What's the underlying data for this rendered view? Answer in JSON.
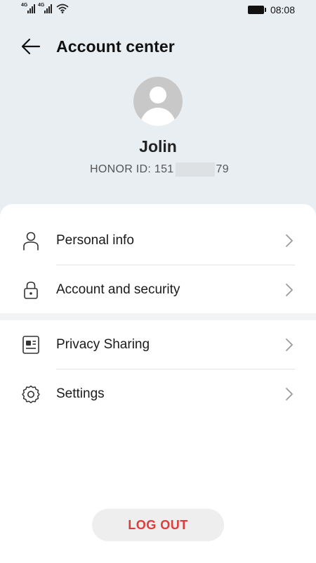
{
  "status_bar": {
    "sim1_label": "4G",
    "sim2_label": "4G",
    "time": "08:08"
  },
  "header": {
    "title": "Account center"
  },
  "profile": {
    "name": "Jolin",
    "id_prefix": "HONOR ID: 151",
    "id_suffix": "79"
  },
  "menu": {
    "group1": [
      {
        "label": "Personal info",
        "icon": "person-icon"
      },
      {
        "label": "Account and security",
        "icon": "lock-icon"
      }
    ],
    "group2": [
      {
        "label": "Privacy Sharing",
        "icon": "id-card-icon"
      },
      {
        "label": "Settings",
        "icon": "gear-icon"
      }
    ]
  },
  "logout": {
    "label": "LOG OUT",
    "color": "#e23b3b"
  },
  "colors": {
    "top_background": "#e9eef2",
    "avatar_placeholder": "#c8c8c8"
  }
}
